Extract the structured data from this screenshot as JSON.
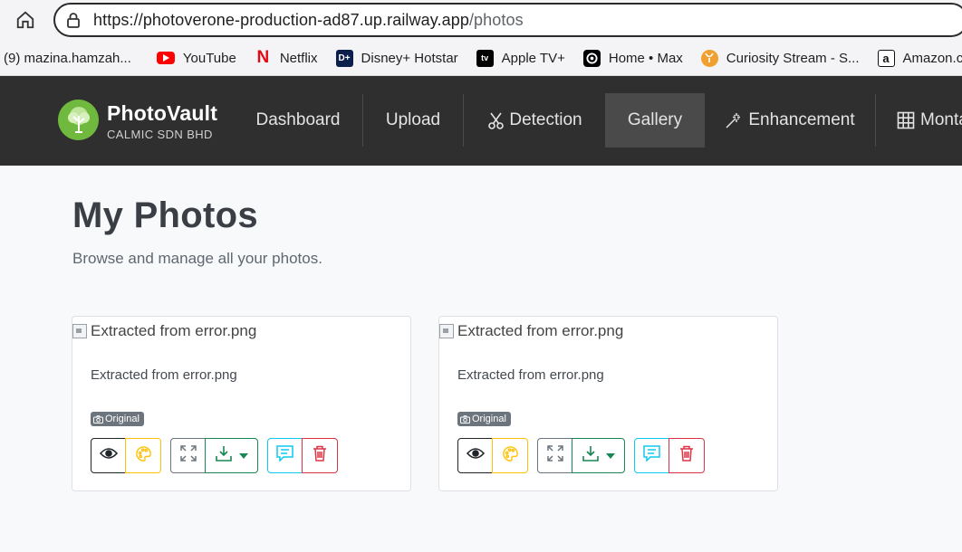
{
  "browser": {
    "url_main": "https://photoverone-production-ad87.up.railway.app",
    "url_path": "/photos",
    "bookmarks": [
      {
        "label": "(9) mazina.hamzah...",
        "icon": "none"
      },
      {
        "label": "YouTube",
        "icon": "youtube-icon",
        "color": "#ff0000"
      },
      {
        "label": "Netflix",
        "icon": "netflix-icon",
        "color": "#e50914"
      },
      {
        "label": "Disney+ Hotstar",
        "icon": "disney-hotstar-icon",
        "color": "#0b1f4d"
      },
      {
        "label": "Apple TV+",
        "icon": "apple-tv-icon",
        "color": "#000000"
      },
      {
        "label": "Home • Max",
        "icon": "max-icon",
        "color": "#000000"
      },
      {
        "label": "Curiosity Stream - S...",
        "icon": "curiosity-stream-icon",
        "color": "#f0a030"
      },
      {
        "label": "Amazon.co",
        "icon": "amazon-icon",
        "color": "#111111"
      }
    ]
  },
  "app": {
    "brand_name": "PhotoVault",
    "brand_sub": "CALMIC SDN BHD",
    "nav": [
      {
        "label": "Dashboard",
        "icon": ""
      },
      {
        "label": "Upload",
        "icon": ""
      },
      {
        "label": "Detection",
        "icon": "scissors-icon"
      },
      {
        "label": "Gallery",
        "icon": "",
        "active": true
      },
      {
        "label": "Enhancement",
        "icon": "magic-wand-icon"
      },
      {
        "label": "Montage",
        "icon": "grid-icon"
      }
    ]
  },
  "main": {
    "title": "My Photos",
    "subtitle": "Browse and manage all your photos.",
    "photos": [
      {
        "alt": "Extracted from error.png",
        "title": "Extracted from error.png",
        "badge": "Original"
      },
      {
        "alt": "Extracted from error.png",
        "title": "Extracted from error.png",
        "badge": "Original"
      }
    ]
  },
  "colors": {
    "navbar_bg": "#2f2f2f",
    "active_nav_bg": "#4a4a4a",
    "brand_green": "#6fb93e",
    "view_btn": "#212529",
    "palette_btn": "#ffc107",
    "expand_btn": "#6c757d",
    "download_btn": "#198754",
    "comment_btn": "#0dcaf0",
    "delete_btn": "#dc3545"
  }
}
